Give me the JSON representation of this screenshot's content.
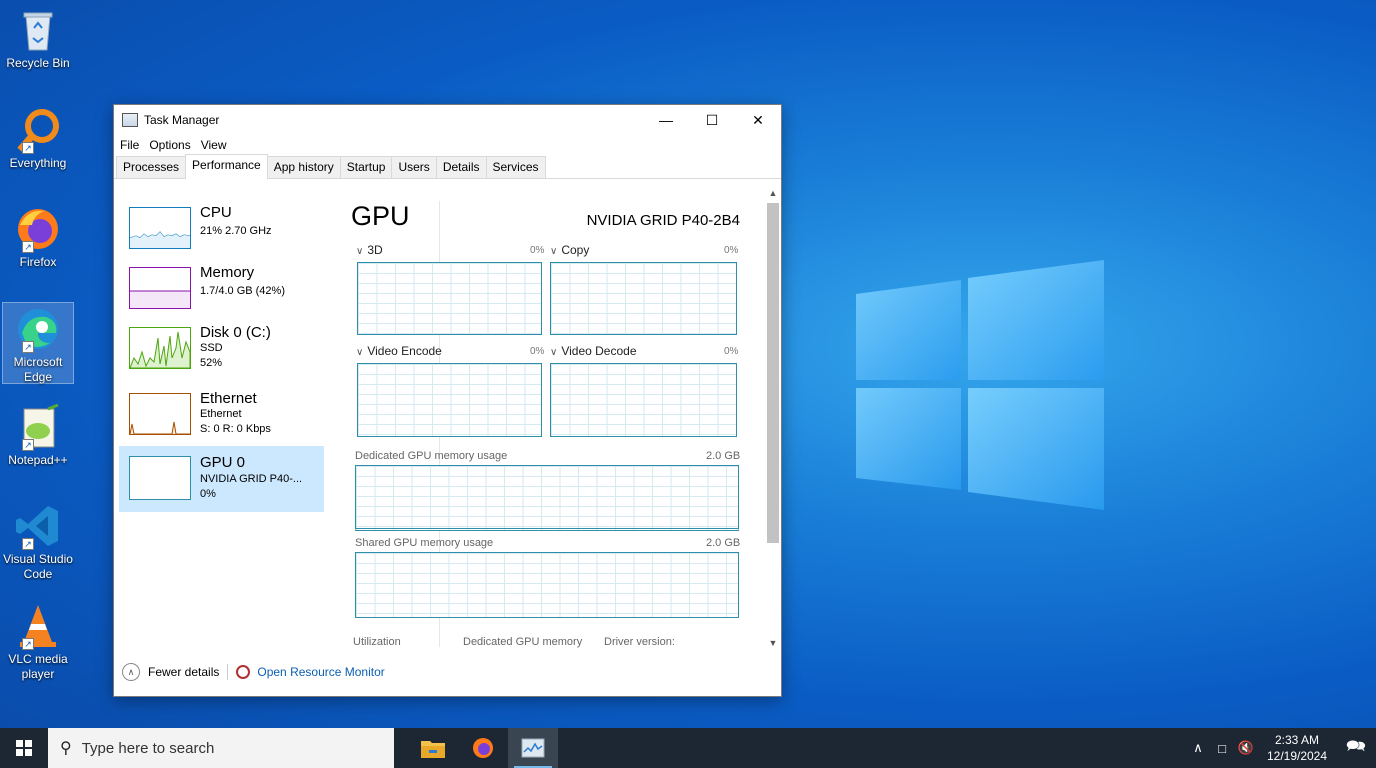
{
  "desktop": {
    "icons": [
      {
        "label": "Recycle Bin"
      },
      {
        "label": "Everything"
      },
      {
        "label": "Firefox"
      },
      {
        "label": "Microsoft Edge"
      },
      {
        "label": "Notepad++"
      },
      {
        "label": "Visual Studio Code"
      },
      {
        "label": "VLC media player"
      }
    ]
  },
  "window": {
    "title": "Task Manager",
    "minimize": "—",
    "maximize": "☐",
    "close": "✕"
  },
  "menu": [
    "File",
    "Options",
    "View"
  ],
  "tabs": [
    "Processes",
    "Performance",
    "App history",
    "Startup",
    "Users",
    "Details",
    "Services"
  ],
  "active_tab": "Performance",
  "resources": [
    {
      "name": "CPU",
      "line1": "21%  2.70 GHz",
      "line2": "",
      "color": "#117dbb"
    },
    {
      "name": "Memory",
      "line1": "1.7/4.0 GB (42%)",
      "line2": "",
      "color": "#8b12ae"
    },
    {
      "name": "Disk 0 (C:)",
      "line1": "SSD",
      "line2": "52%",
      "color": "#4da60c"
    },
    {
      "name": "Ethernet",
      "line1": "Ethernet",
      "line2": "S: 0  R: 0 Kbps",
      "color": "#a74f01"
    },
    {
      "name": "GPU 0",
      "line1": "NVIDIA GRID P40-...",
      "line2": "0%",
      "color": "#2f8fa8"
    }
  ],
  "gpu": {
    "title": "GPU",
    "model": "NVIDIA GRID P40-2B4",
    "engines": [
      {
        "label": "3D",
        "value": "0%"
      },
      {
        "label": "Copy",
        "value": "0%"
      },
      {
        "label": "Video Encode",
        "value": "0%"
      },
      {
        "label": "Video Decode",
        "value": "0%"
      }
    ],
    "dedicated_label": "Dedicated GPU memory usage",
    "dedicated_max": "2.0 GB",
    "shared_label": "Shared GPU memory usage",
    "shared_max": "2.0 GB",
    "stats": [
      "Utilization",
      "Dedicated GPU memory",
      "Driver version:"
    ]
  },
  "footer": {
    "fewer_details": "Fewer details",
    "open_resmon": "Open Resource Monitor"
  },
  "taskbar": {
    "search_placeholder": "Type here to search",
    "time": "2:33 AM",
    "date": "12/19/2024"
  }
}
